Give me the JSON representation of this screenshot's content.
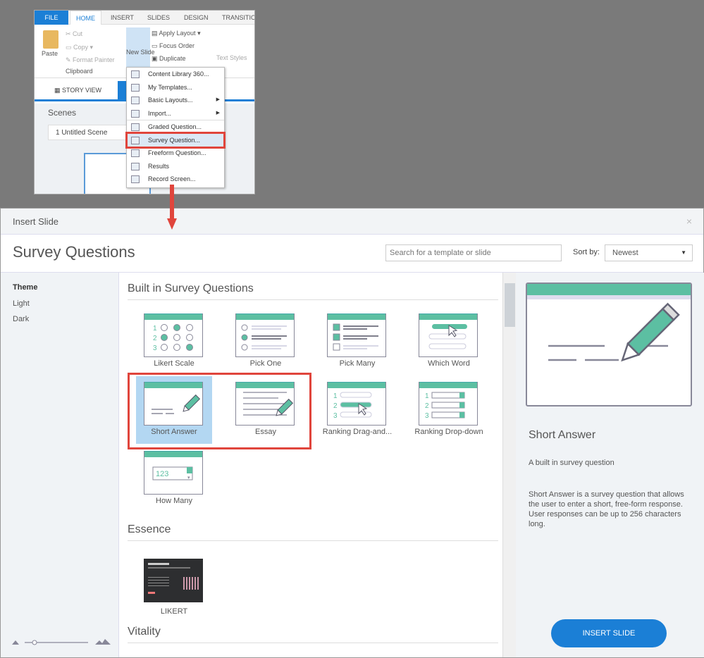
{
  "ribbon": {
    "tabs": [
      "FILE",
      "HOME",
      "INSERT",
      "SLIDES",
      "DESIGN",
      "TRANSITIO"
    ],
    "paste": "Paste",
    "cut": "Cut",
    "copy": "Copy",
    "format_painter": "Format Painter",
    "clipboard": "Clipboard",
    "new_slide": "New Slide",
    "apply_layout": "Apply Layout",
    "focus_order": "Focus Order",
    "duplicate": "Duplicate",
    "text_styles": "Text Styles",
    "story_view": "STORY VIEW",
    "scenes": "Scenes",
    "scene_item": "1 Untitled Scene"
  },
  "menu": [
    {
      "label": "Content Library 360..."
    },
    {
      "label": "My Templates..."
    },
    {
      "label": "Basic Layouts..."
    },
    {
      "label": "Import..."
    },
    {
      "label": "Graded Question..."
    },
    {
      "label": "Survey Question..."
    },
    {
      "label": "Freeform Question..."
    },
    {
      "label": "Results"
    },
    {
      "label": "Record Screen..."
    }
  ],
  "dialog": {
    "window_title": "Insert Slide",
    "close": "×",
    "title": "Survey Questions",
    "search_placeholder": "Search for a template or slide",
    "sort_label": "Sort by:",
    "sort_value": "Newest"
  },
  "sidebar": {
    "header": "Theme",
    "items": [
      "Light",
      "Dark"
    ]
  },
  "sections": [
    {
      "title": "Built in Survey Questions",
      "items": [
        {
          "label": "Likert Scale"
        },
        {
          "label": "Pick One"
        },
        {
          "label": "Pick Many"
        },
        {
          "label": "Which Word"
        },
        {
          "label": "Short Answer"
        },
        {
          "label": "Essay"
        },
        {
          "label": "Ranking  Drag-and..."
        },
        {
          "label": "Ranking Drop-down"
        },
        {
          "label": "How Many"
        }
      ]
    },
    {
      "title": "Essence",
      "items": [
        {
          "label": "LIKERT"
        }
      ]
    },
    {
      "title": "Vitality"
    }
  ],
  "how_many_value": "123",
  "preview": {
    "name": "Short Answer",
    "subtitle": "A built in survey question",
    "description": "Short Answer is a survey question that allows the user to enter a short, free-form response. User responses can be up to 256 characters long.",
    "insert_button": "INSERT SLIDE"
  },
  "colors": {
    "accent": "#1b7fd6",
    "teal": "#5cbfa2",
    "highlight_red": "#e0453c"
  }
}
